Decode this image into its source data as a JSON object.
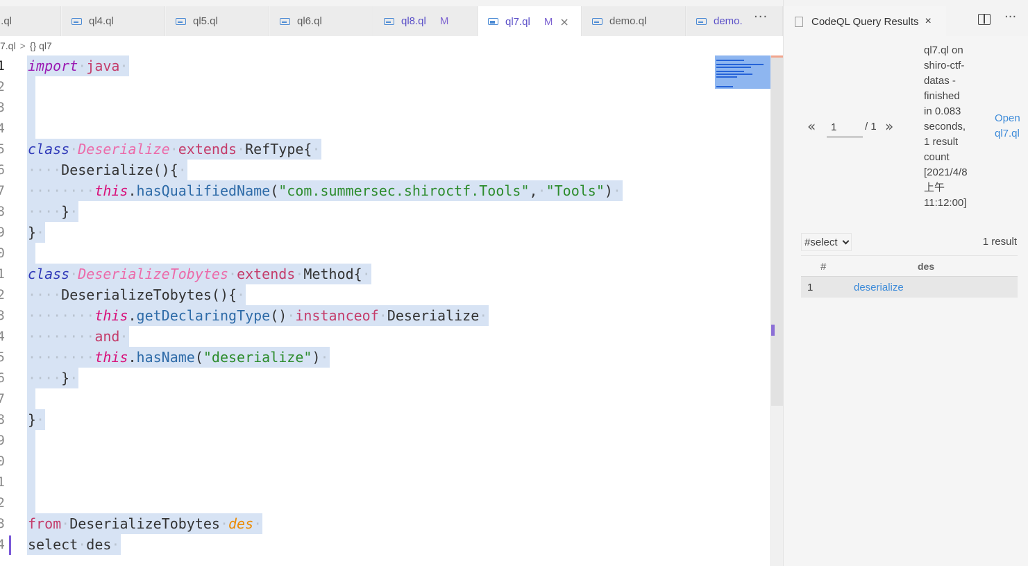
{
  "editor": {
    "tabs": [
      {
        "label": ".ql",
        "modified": false,
        "active": false,
        "icon": "codeql-file-icon"
      },
      {
        "label": "ql4.ql",
        "modified": false,
        "active": false,
        "icon": "codeql-file-icon"
      },
      {
        "label": "ql5.ql",
        "modified": false,
        "active": false,
        "icon": "codeql-file-icon"
      },
      {
        "label": "ql6.ql",
        "modified": false,
        "active": false,
        "icon": "codeql-file-icon"
      },
      {
        "label": "ql8.ql",
        "modified": true,
        "modified_marker": "M",
        "active": false,
        "icon": "codeql-file-icon"
      },
      {
        "label": "ql7.ql",
        "modified": true,
        "modified_marker": "M",
        "active": true,
        "close": "×",
        "icon": "codeql-file-icon"
      },
      {
        "label": "demo.ql",
        "modified": false,
        "active": false,
        "icon": "codeql-file-icon"
      },
      {
        "label": "demo.",
        "modified": true,
        "active": false,
        "icon": "codeql-file-icon"
      }
    ],
    "tab_more": "···",
    "breadcrumb": {
      "file": "7.ql",
      "separator": ">",
      "symbol_icon": "{}",
      "symbol": "ql7"
    },
    "lines": [
      {
        "n": "1",
        "current": true,
        "tokens": [
          [
            "k-import",
            "import"
          ],
          [
            "ws",
            "·"
          ],
          [
            "k-type",
            "java"
          ],
          [
            "ws",
            "·"
          ]
        ]
      },
      {
        "n": "2",
        "current": false,
        "tokens": []
      },
      {
        "n": "3",
        "current": false,
        "tokens": []
      },
      {
        "n": "4",
        "current": false,
        "tokens": []
      },
      {
        "n": "5",
        "current": false,
        "tokens": [
          [
            "k-blue",
            "class"
          ],
          [
            "ws",
            "·"
          ],
          [
            "k-name",
            "Deserialize"
          ],
          [
            "ws",
            "·"
          ],
          [
            "k-type",
            "extends"
          ],
          [
            "ws",
            "·"
          ],
          [
            "",
            "RefType{"
          ],
          [
            "ws",
            "·"
          ]
        ]
      },
      {
        "n": "6",
        "current": false,
        "tokens": [
          [
            "ws",
            "····"
          ],
          [
            "",
            "Deserialize(){"
          ],
          [
            "ws",
            "·"
          ]
        ]
      },
      {
        "n": "7",
        "current": false,
        "tokens": [
          [
            "ws",
            "········"
          ],
          [
            "k-this",
            "this"
          ],
          [
            "",
            ".",
            ""
          ],
          [
            "k-func",
            "hasQualifiedName"
          ],
          [
            "",
            "("
          ],
          [
            "k-str",
            "\"com.summersec.shiroctf.Tools\""
          ],
          [
            "",
            ","
          ],
          [
            "ws",
            "·"
          ],
          [
            "k-str",
            "\"Tools\""
          ],
          [
            "",
            ")"
          ],
          [
            "ws",
            "·"
          ]
        ]
      },
      {
        "n": "8",
        "current": false,
        "tokens": [
          [
            "ws",
            "····"
          ],
          [
            "",
            "}"
          ],
          [
            "ws",
            "·"
          ]
        ]
      },
      {
        "n": "9",
        "current": false,
        "tokens": [
          [
            "",
            "}"
          ],
          [
            "ws",
            "·"
          ]
        ]
      },
      {
        "n": "0",
        "current": false,
        "tokens": []
      },
      {
        "n": "1",
        "current": false,
        "tokens": [
          [
            "k-blue",
            "class"
          ],
          [
            "ws",
            "·"
          ],
          [
            "k-name",
            "DeserializeTobytes"
          ],
          [
            "ws",
            "·"
          ],
          [
            "k-type",
            "extends"
          ],
          [
            "ws",
            "·"
          ],
          [
            "",
            "Method{"
          ],
          [
            "ws",
            "·"
          ]
        ]
      },
      {
        "n": "2",
        "current": false,
        "tokens": [
          [
            "ws",
            "····"
          ],
          [
            "",
            "DeserializeTobytes(){"
          ],
          [
            "ws",
            "·"
          ]
        ]
      },
      {
        "n": "3",
        "current": false,
        "tokens": [
          [
            "ws",
            "········"
          ],
          [
            "k-this",
            "this"
          ],
          [
            "",
            "."
          ],
          [
            "k-func",
            "getDeclaringType"
          ],
          [
            "",
            "()"
          ],
          [
            "ws",
            "·"
          ],
          [
            "k-type",
            "instanceof"
          ],
          [
            "ws",
            "·"
          ],
          [
            "",
            "Deserialize"
          ],
          [
            "ws",
            "·"
          ]
        ]
      },
      {
        "n": "4",
        "current": false,
        "tokens": [
          [
            "ws",
            "········"
          ],
          [
            "k-type",
            "and"
          ],
          [
            "ws",
            "·"
          ]
        ]
      },
      {
        "n": "5",
        "current": false,
        "tokens": [
          [
            "ws",
            "········"
          ],
          [
            "k-this",
            "this"
          ],
          [
            "",
            "."
          ],
          [
            "k-func",
            "hasName"
          ],
          [
            "",
            "("
          ],
          [
            "k-str",
            "\"deserialize\""
          ],
          [
            "",
            ")"
          ],
          [
            "ws",
            "·"
          ]
        ]
      },
      {
        "n": "6",
        "current": false,
        "tokens": [
          [
            "ws",
            "····"
          ],
          [
            "",
            "}"
          ],
          [
            "ws",
            "·"
          ]
        ]
      },
      {
        "n": "7",
        "current": false,
        "tokens": []
      },
      {
        "n": "8",
        "current": false,
        "tokens": [
          [
            "",
            "}"
          ],
          [
            "ws",
            "·"
          ]
        ]
      },
      {
        "n": "9",
        "current": false,
        "tokens": []
      },
      {
        "n": "0",
        "current": false,
        "tokens": []
      },
      {
        "n": "1",
        "current": false,
        "tokens": []
      },
      {
        "n": "2",
        "current": false,
        "tokens": []
      },
      {
        "n": "3",
        "current": false,
        "tokens": [
          [
            "k-type",
            "from"
          ],
          [
            "ws",
            "·"
          ],
          [
            "",
            "DeserializeTobytes"
          ],
          [
            "ws",
            "·"
          ],
          [
            "k-var",
            "des"
          ],
          [
            "ws",
            "·"
          ]
        ]
      },
      {
        "n": "4",
        "current": false,
        "tokens": [
          [
            "",
            "select"
          ],
          [
            "ws",
            "·"
          ],
          [
            "",
            "des"
          ],
          [
            "ws",
            "·"
          ]
        ]
      }
    ]
  },
  "results_panel": {
    "tab_title": "CodeQL Query Results",
    "tab_close": "×",
    "more": "···",
    "pager": {
      "prev": "«",
      "current_page": "1",
      "total": "/ 1",
      "next": "»"
    },
    "query_info": "ql7.ql on\nshiro-ctf-\ndatas -\nfinished\nin 0.083\nseconds,\n1 result\ncount\n[2021/4/8\n上午\n11:12:00]",
    "open_link": "Open\nql7.ql",
    "select_dropdown": "#select",
    "result_count": "1 result",
    "table": {
      "columns": [
        "#",
        "des"
      ],
      "rows": [
        [
          "1",
          "deserialize"
        ]
      ]
    }
  },
  "colors": {
    "selection": "#d7e3f4",
    "keyword_class": "#2f39b8",
    "type_keyword": "#c43c6a",
    "class_name": "#ec6aa9",
    "this_keyword": "#d8117a",
    "string": "#2d8c2d",
    "variable": "#eb8a00",
    "link": "#3d8bd9",
    "modified": "#7d63d1"
  }
}
